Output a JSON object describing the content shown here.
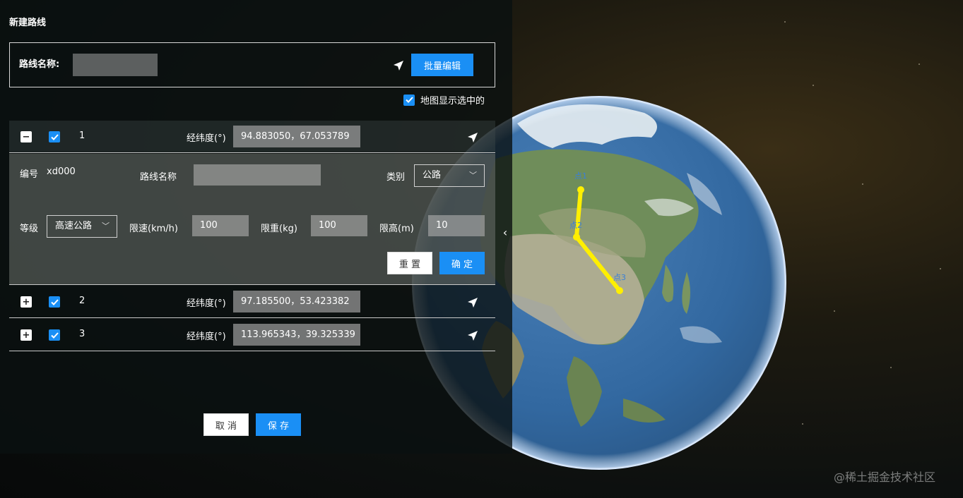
{
  "panel": {
    "title": "新建路线",
    "route_name_label": "路线名称:",
    "route_name_value": "",
    "batch_edit_label": "批量编辑",
    "show_selected_label": "地图显示选中的",
    "cancel_label": "取 消",
    "save_label": "保 存"
  },
  "points": [
    {
      "index": "1",
      "coord_label": "经纬度(°)",
      "coord_value": "94.883050，67.053789",
      "expanded": true,
      "checked": true
    },
    {
      "index": "2",
      "coord_label": "经纬度(°)",
      "coord_value": "97.185500，53.423382",
      "expanded": false,
      "checked": true
    },
    {
      "index": "3",
      "coord_label": "经纬度(°)",
      "coord_value": "113.965343，39.325339",
      "expanded": false,
      "checked": true
    }
  ],
  "detail": {
    "id_label": "编号",
    "id_value": "xd000",
    "route_name_label": "路线名称",
    "route_name_value": "",
    "category_label": "类别",
    "category_value": "公路",
    "grade_label": "等级",
    "grade_value": "高速公路",
    "speed_label": "限速(km/h)",
    "speed_value": "100",
    "weight_label": "限重(kg)",
    "weight_value": "100",
    "height_label": "限高(m)",
    "height_value": "10",
    "reset_label": "重 置",
    "confirm_label": "确 定"
  },
  "map": {
    "markers": [
      "点1",
      "点2",
      "点3"
    ],
    "route_color": "#ffef00"
  },
  "watermark": "@稀土掘金技术社区",
  "colors": {
    "accent": "#1a8ff5"
  }
}
